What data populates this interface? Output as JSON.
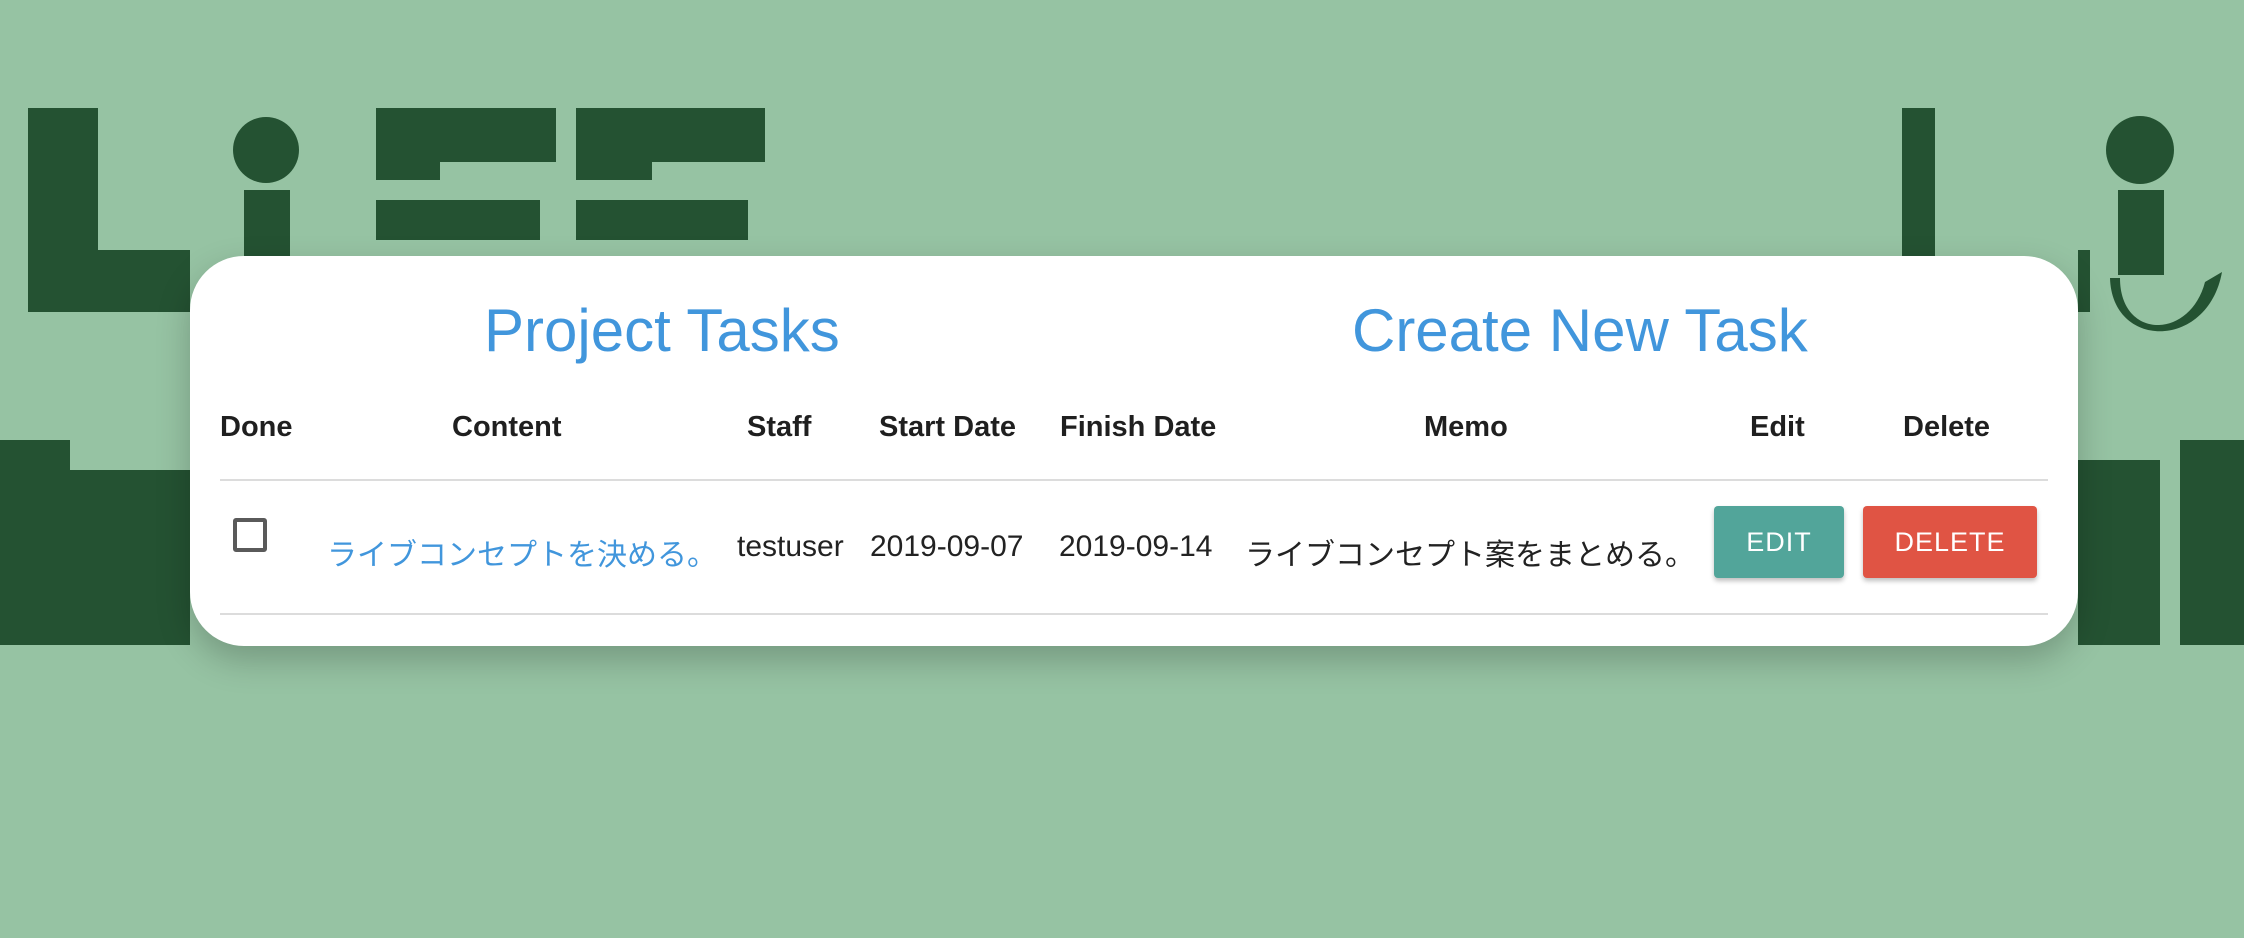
{
  "links": {
    "project_tasks": "Project Tasks",
    "create_new_task": "Create New Task"
  },
  "table": {
    "headers": [
      "Done",
      "Content",
      "Staff",
      "Start Date",
      "Finish Date",
      "Memo",
      "Edit",
      "Delete"
    ],
    "rows": [
      {
        "done": false,
        "content": "ライブコンセプトを決める。",
        "staff": "testuser",
        "start_date": "2019-09-07",
        "finish_date": "2019-09-14",
        "memo": "ライブコンセプト案をまとめる。",
        "edit_label": "EDIT",
        "delete_label": "DELETE"
      }
    ]
  },
  "colors": {
    "background": "#96c3a3",
    "logo": "#245232",
    "link": "#4196dc",
    "edit_button": "#52a59a",
    "delete_button": "#e05444"
  },
  "icons": {
    "background": "life-logo-letters"
  }
}
